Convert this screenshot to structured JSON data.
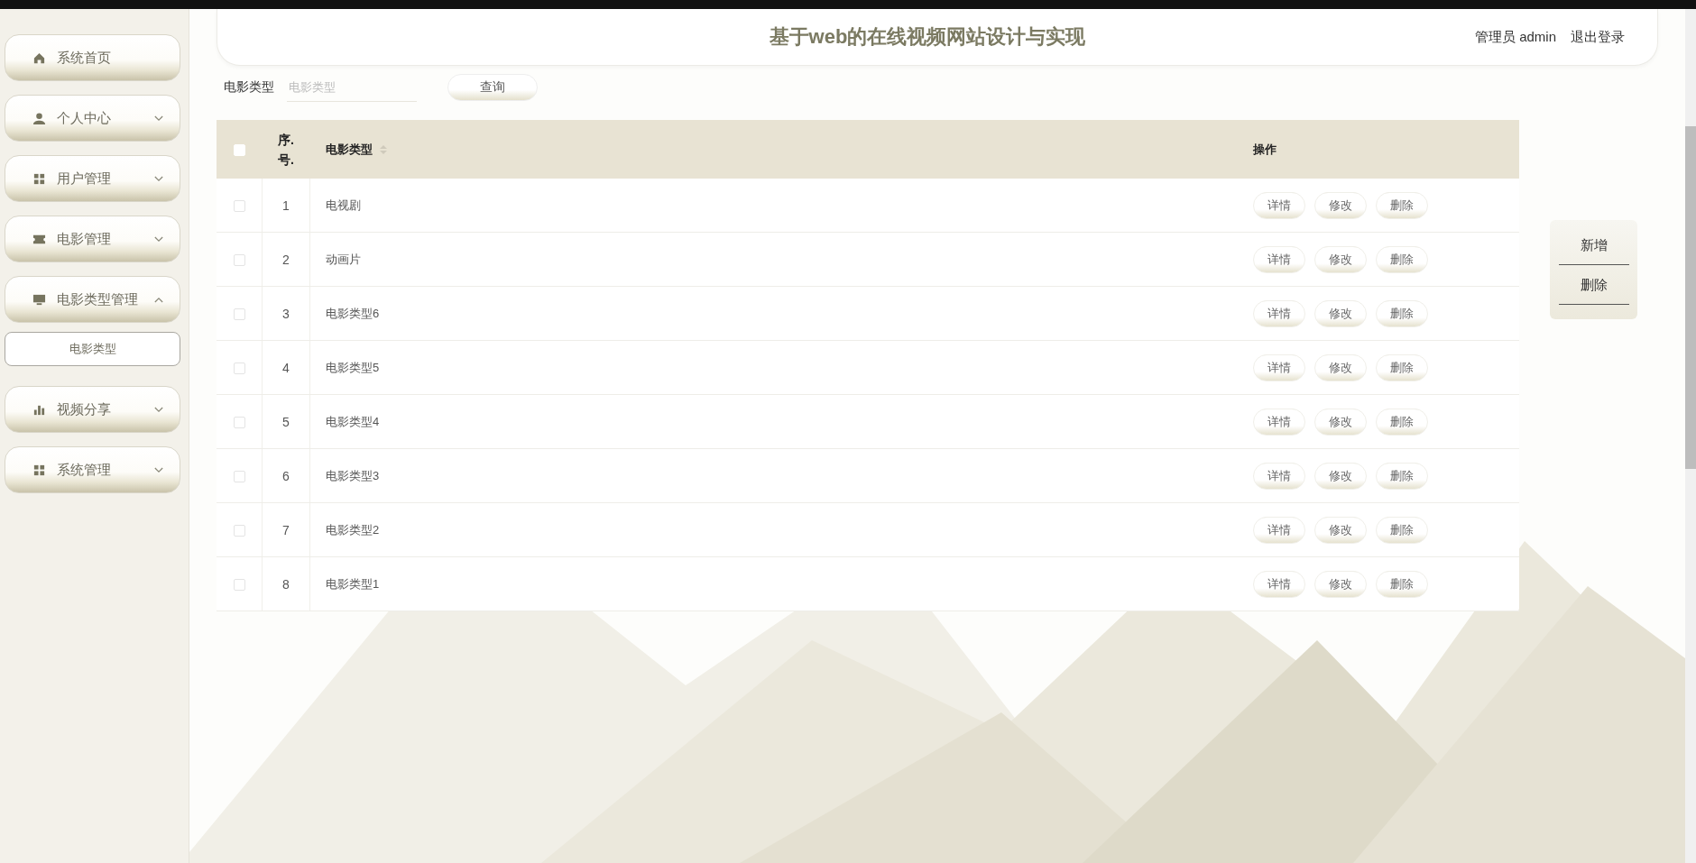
{
  "header": {
    "title": "基于web的在线视频网站设计与实现",
    "user_label": "管理员 admin",
    "logout": "退出登录"
  },
  "sidebar": {
    "items": [
      {
        "label": "系统首页"
      },
      {
        "label": "个人中心",
        "expanded": false
      },
      {
        "label": "用户管理",
        "expanded": false
      },
      {
        "label": "电影管理",
        "expanded": false
      },
      {
        "label": "电影类型管理",
        "expanded": true,
        "children": [
          {
            "label": "电影类型",
            "selected": false
          }
        ]
      },
      {
        "label": "视频分享",
        "expanded": false
      },
      {
        "label": "系统管理",
        "expanded": false
      }
    ]
  },
  "search": {
    "label": "电影类型",
    "placeholder": "电影类型",
    "button": "查询"
  },
  "table": {
    "select_all_checked": false,
    "columns": [
      "序.号.",
      "电影类型",
      "操作"
    ],
    "rows": [
      {
        "checked": false,
        "index": "1",
        "type": "电视剧",
        "actions": [
          "详情",
          "修改",
          "删除"
        ]
      },
      {
        "checked": false,
        "index": "2",
        "type": "动画片",
        "actions": [
          "详情",
          "修改",
          "删除"
        ]
      },
      {
        "checked": false,
        "index": "3",
        "type": "电影类型6",
        "actions": [
          "详情",
          "修改",
          "删除"
        ]
      },
      {
        "checked": false,
        "index": "4",
        "type": "电影类型5",
        "actions": [
          "详情",
          "修改",
          "删除"
        ]
      },
      {
        "checked": false,
        "index": "5",
        "type": "电影类型4",
        "actions": [
          "详情",
          "修改",
          "删除"
        ]
      },
      {
        "checked": false,
        "index": "6",
        "type": "电影类型3",
        "actions": [
          "详情",
          "修改",
          "删除"
        ]
      },
      {
        "checked": false,
        "index": "7",
        "type": "电影类型2",
        "actions": [
          "详情",
          "修改",
          "删除"
        ]
      },
      {
        "checked": false,
        "index": "8",
        "type": "电影类型1",
        "actions": [
          "详情",
          "修改",
          "删除"
        ]
      }
    ]
  },
  "side_actions": [
    "新增",
    "删除"
  ]
}
